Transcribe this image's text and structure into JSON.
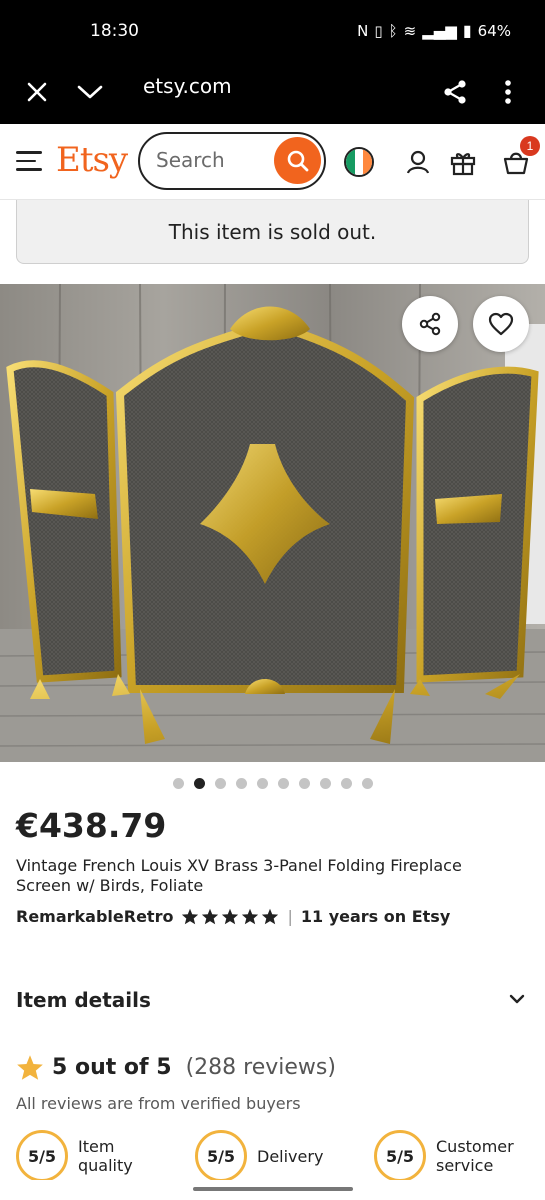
{
  "status_bar": {
    "time": "18:30",
    "battery": "64%"
  },
  "browser": {
    "url": "etsy.com"
  },
  "header": {
    "logo": "Etsy",
    "search_placeholder": "Search",
    "cart_count": "1"
  },
  "notice": {
    "sold_out": "This item is sold out."
  },
  "carousel": {
    "total": 10,
    "active_index": 1
  },
  "listing": {
    "price": "€438.79",
    "title": "Vintage French Louis XV Brass 3-Panel Folding Fireplace Screen w/ Birds, Foliate",
    "seller": "RemarkableRetro",
    "seller_stars": 5,
    "years_on_etsy": "11 years on Etsy"
  },
  "item_details": {
    "label": "Item details"
  },
  "reviews": {
    "rating_text": "5 out of 5",
    "count_text": "(288 reviews)",
    "verified_text": "All reviews are from verified buyers",
    "scores": [
      {
        "value": "5/5",
        "label": "Item quality"
      },
      {
        "value": "5/5",
        "label": "Delivery"
      },
      {
        "value": "5/5",
        "label": "Customer service"
      }
    ]
  },
  "colors": {
    "brand": "#f1641e",
    "star": "#f2b33d",
    "badge": "#d9391f"
  }
}
